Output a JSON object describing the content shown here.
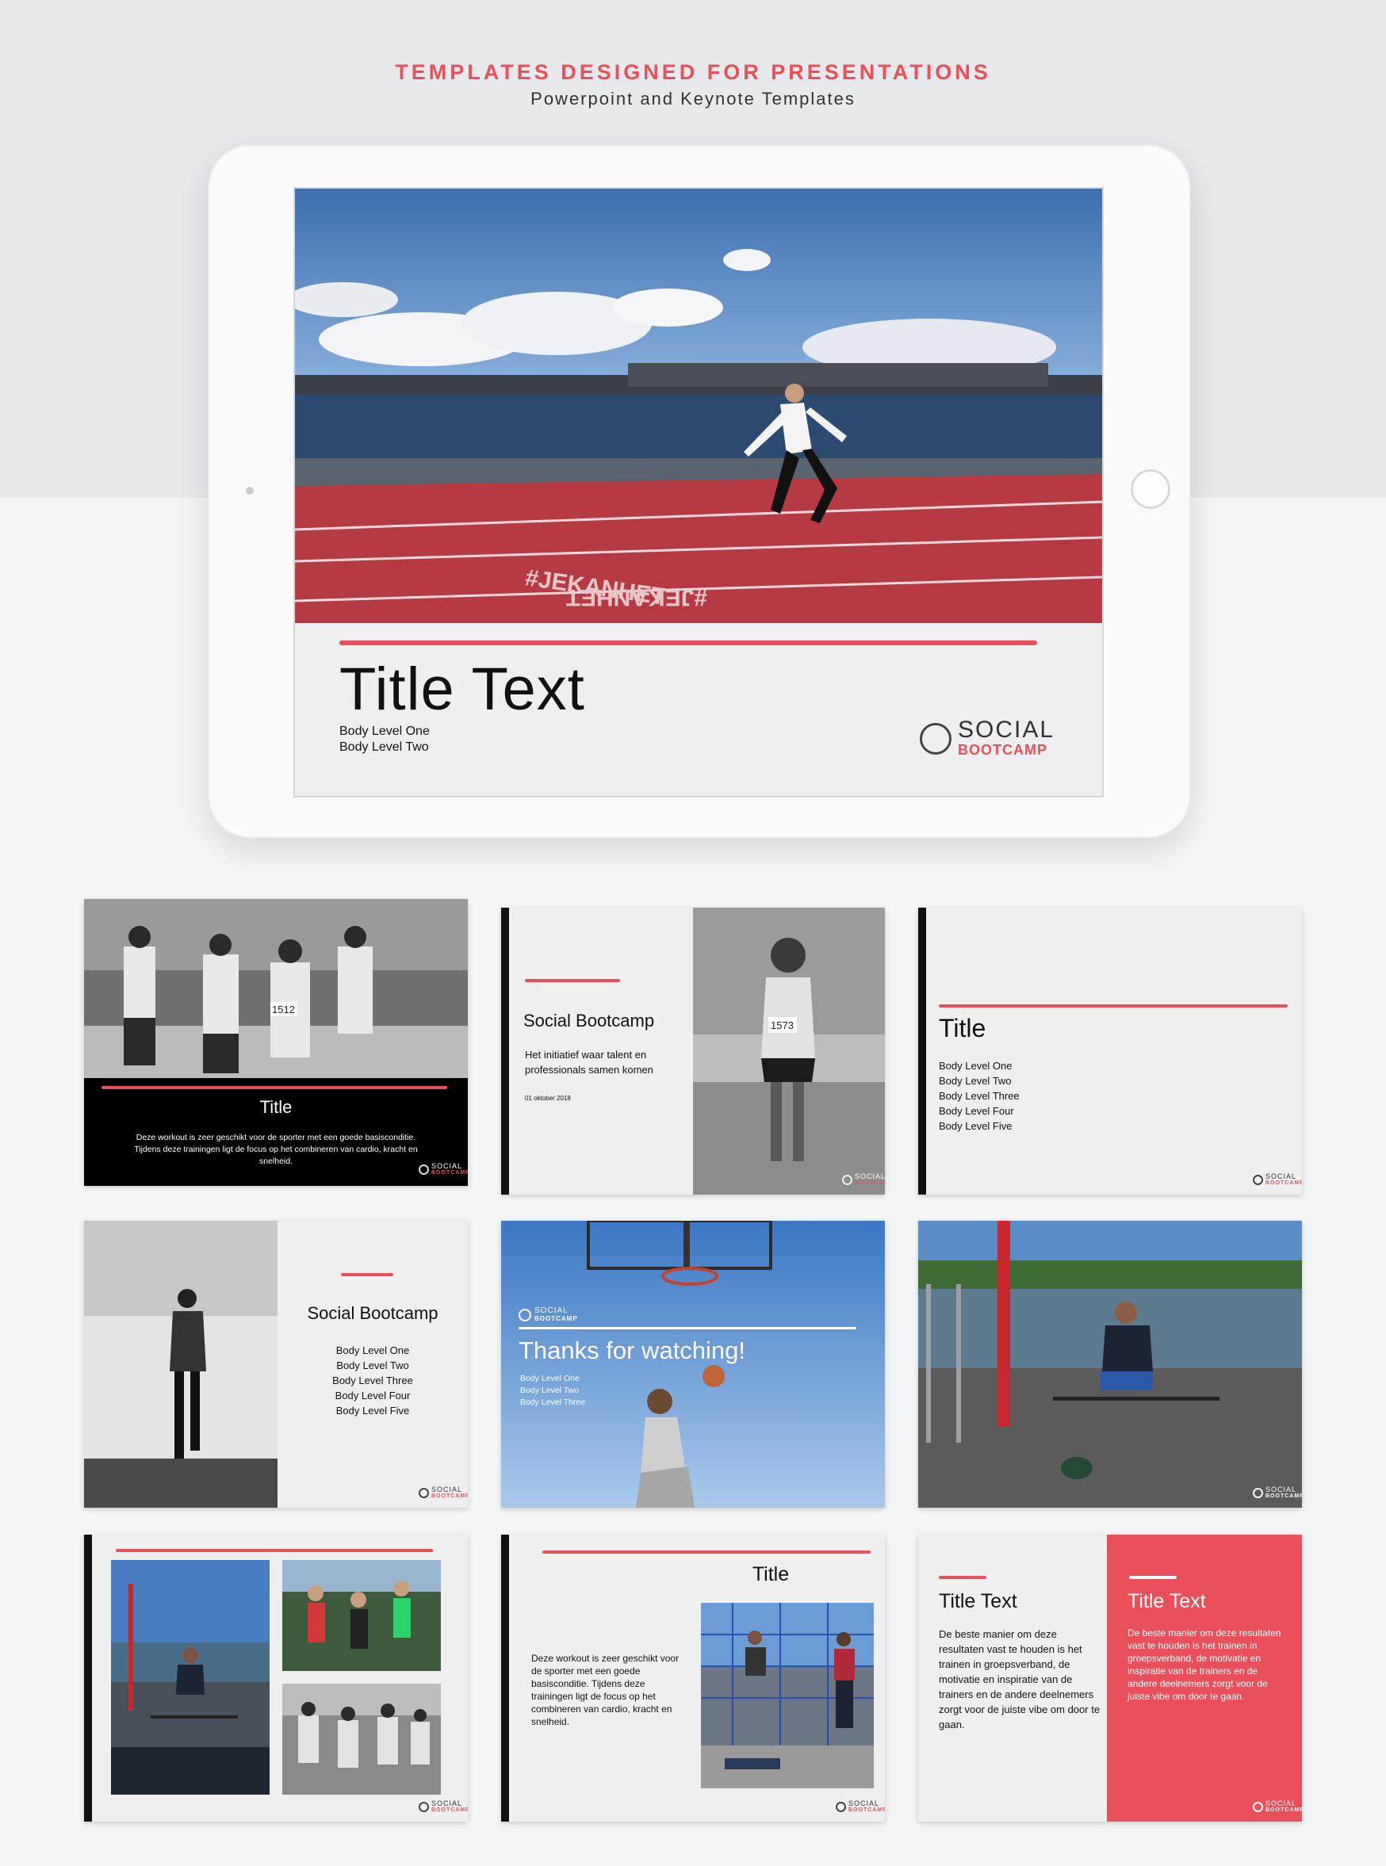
{
  "header": {
    "headline": "TEMPLATES DESIGNED FOR PRESENTATIONS",
    "subline": "Powerpoint and Keynote Templates"
  },
  "colors": {
    "accent": "#e9505a",
    "dark": "#111111",
    "slide_bg": "#efefef",
    "band": "#e7e9ed"
  },
  "logo": {
    "word1": "SOCIAL",
    "word2": "BOOTCAMP"
  },
  "main_slide": {
    "track_text": "#JEKANHET",
    "title": "Title Text",
    "body": [
      "Body Level One",
      "Body Level Two"
    ]
  },
  "slides": {
    "s1": {
      "title": "Title",
      "body": "Deze workout is zeer geschikt voor de sporter met een goede basisconditie. Tijdens deze trainingen ligt de focus op het combineren van cardio, kracht en snelheid.",
      "bib1": "1512"
    },
    "s2": {
      "title": "Social Bootcamp",
      "body": "Het initiatief waar talent en professionals samen komen",
      "date": "01 oktober 2018",
      "bib": "1573"
    },
    "s3": {
      "title": "Title",
      "body": [
        "Body Level One",
        "Body Level Two",
        "Body Level Three",
        "Body Level Four",
        "Body Level Five"
      ]
    },
    "s4": {
      "title": "Social Bootcamp",
      "body": [
        "Body Level One",
        "Body Level Two",
        "Body Level Three",
        "Body Level Four",
        "Body Level Five"
      ]
    },
    "s5": {
      "title": "Thanks for watching!",
      "body": [
        "Body Level One",
        "Body Level Two",
        "Body Level Three"
      ]
    },
    "s8": {
      "title": "Title",
      "body": "Deze workout is zeer geschikt voor de sporter met een goede basisconditie. Tijdens deze trainingen ligt de focus op het combineren van cardio, kracht en snelheid."
    },
    "s9": {
      "left_title": "Title Text",
      "left_body": "De beste manier om deze resultaten vast te houden is het trainen in groepsverband, de motivatie en inspiratie van de trainers en de andere deelnemers zorgt voor de juiste vibe om door te gaan.",
      "right_title": "Title Text",
      "right_body": "De beste manier om deze resultaten vast te houden is het trainen in groepsverband, de motivatie en inspiratie van de trainers en de andere deelnemers zorgt voor de juiste vibe om door te gaan."
    }
  }
}
